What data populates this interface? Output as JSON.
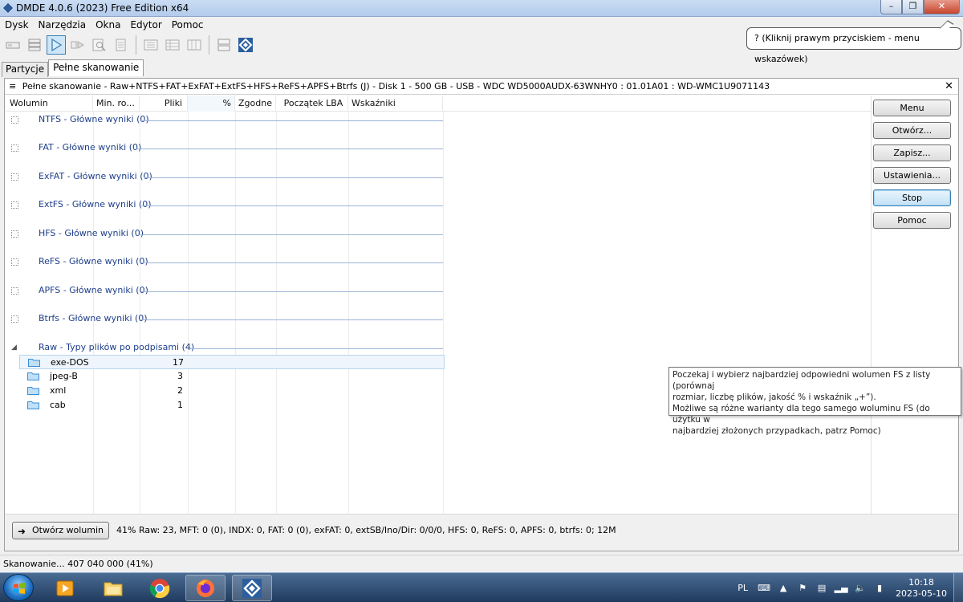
{
  "window": {
    "title": "DMDE 4.0.6 (2023) Free Edition x64",
    "controls": [
      "–",
      "❐",
      "✕"
    ]
  },
  "menu": [
    "Dysk",
    "Narzędzia",
    "Okna",
    "Edytor",
    "Pomoc"
  ],
  "hint_balloon": "? (Kliknij prawym przyciskiem - menu wskazówek)",
  "tabs": [
    {
      "label": "Partycje",
      "active": false
    },
    {
      "label": "Pełne skanowanie",
      "active": true
    }
  ],
  "panel": {
    "header": "Pełne skanowanie - Raw+NTFS+FAT+ExFAT+ExtFS+HFS+ReFS+APFS+Btrfs (J) - Disk 1 - 500 GB - USB - WDC WD5000AUDX-63WNHY0 : 01.01A01 : WD-WMC1U9071143",
    "menu_glyph": "≡",
    "close_glyph": "✕"
  },
  "columns": [
    "Wolumin",
    "Min. ro...",
    "Pliki",
    "%",
    "Zgodne",
    "Początek LBA",
    "Wskaźniki"
  ],
  "groups": [
    {
      "label": "NTFS - Główne wyniki (0)"
    },
    {
      "label": "FAT - Główne wyniki (0)"
    },
    {
      "label": "ExFAT - Główne wyniki (0)"
    },
    {
      "label": "ExtFS - Główne wyniki (0)"
    },
    {
      "label": "HFS - Główne wyniki (0)"
    },
    {
      "label": "ReFS - Główne wyniki (0)"
    },
    {
      "label": "APFS - Główne wyniki (0)"
    },
    {
      "label": "Btrfs - Główne wyniki (0)"
    },
    {
      "label": "Raw - Typy plików po podpisami (4)",
      "expanded": true
    }
  ],
  "raw_files": [
    {
      "name": "exe-DOS",
      "count": "17"
    },
    {
      "name": "jpeg-B",
      "count": "3"
    },
    {
      "name": "xml",
      "count": "2"
    },
    {
      "name": "cab",
      "count": "1"
    }
  ],
  "side_buttons": [
    "Menu",
    "Otwórz...",
    "Zapisz...",
    "Ustawienia...",
    "Stop",
    "Pomoc"
  ],
  "tooltip": {
    "line1": "Poczekaj i wybierz najbardziej odpowiedni wolumen FS z listy (porównaj",
    "line2": "rozmiar, liczbę plików, jakość % i wskaźnik „+”).",
    "line3": "Możliwe są różne warianty dla tego samego woluminu FS (do użytku w",
    "line4": "najbardziej złożonych przypadkach, patrz Pomoc)"
  },
  "footer": {
    "open_button": "Otwórz wolumin",
    "stats": "41% Raw: 23, MFT: 0 (0), INDX: 0, FAT: 0 (0), exFAT: 0, extSB/Ino/Dir: 0/0/0, HFS: 0, ReFS: 0, APFS: 0, btrfs: 0; 12M"
  },
  "status_bar": "Skanowanie... 407 040 000 (41%)",
  "taskbar": {
    "language": "PL",
    "time": "10:18",
    "date": "2023-05-10"
  },
  "colors": {
    "group_text": "#1e3f8a",
    "accent": "#3c7fb1",
    "taskbar": "#1f3a5e"
  }
}
